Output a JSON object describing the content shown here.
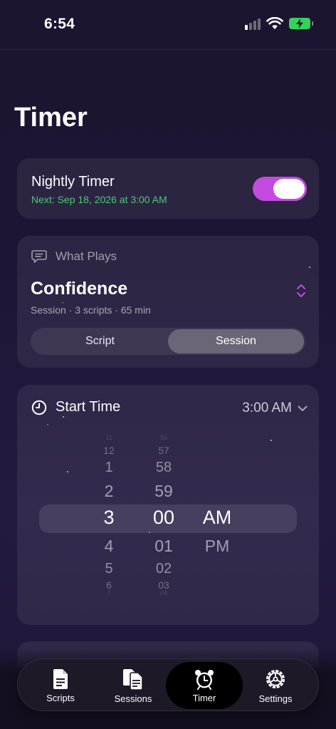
{
  "status_bar": {
    "time": "6:54",
    "icons": [
      "cellular-signal-icon",
      "wifi-icon",
      "battery-charging-icon"
    ],
    "battery_color": "#35d15a"
  },
  "page": {
    "title": "Timer"
  },
  "nightly_timer": {
    "title": "Nightly Timer",
    "next_run": "Next: Sep 18, 2026 at 3:00 AM",
    "enabled": true,
    "accent_color": "#c44be0",
    "next_color": "#4cc874"
  },
  "what_plays": {
    "label": "What Plays",
    "icon": "speech-bubble-icon",
    "title": "Confidence",
    "meta": "Session · 3 scripts · 65 min",
    "segments": [
      {
        "label": "Script",
        "selected": false
      },
      {
        "label": "Session",
        "selected": true
      }
    ]
  },
  "start_time": {
    "label": "Start Time",
    "icon": "clock-icon",
    "value": "3:00 AM",
    "picker": {
      "hours": [
        "11",
        "12",
        "1",
        "2",
        "3",
        "4",
        "5",
        "6",
        "7"
      ],
      "minutes": [
        "56",
        "57",
        "58",
        "59",
        "00",
        "01",
        "02",
        "03",
        "04"
      ],
      "periods": [
        "AM",
        "PM"
      ],
      "selected_hour": "3",
      "selected_minute": "00",
      "selected_period": "AM"
    }
  },
  "tab_bar": {
    "tabs": [
      {
        "label": "Scripts",
        "icon": "document-icon",
        "active": false
      },
      {
        "label": "Sessions",
        "icon": "documents-stack-icon",
        "active": false
      },
      {
        "label": "Timer",
        "icon": "alarm-clock-icon",
        "active": true
      },
      {
        "label": "Settings",
        "icon": "gear-icon",
        "active": false
      }
    ]
  }
}
